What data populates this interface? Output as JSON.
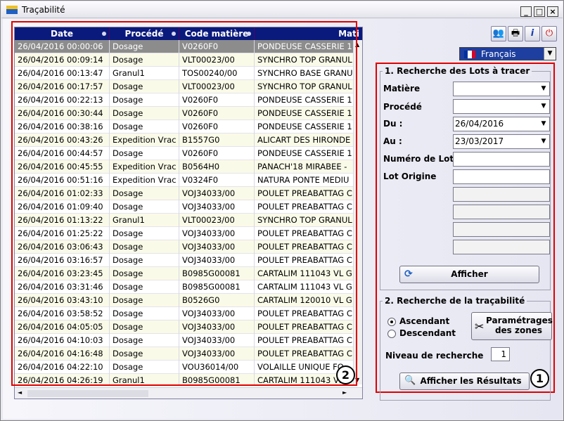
{
  "window": {
    "title": "Traçabilité",
    "controls": [
      "_",
      "□",
      "×"
    ]
  },
  "grid": {
    "columns": [
      "Date",
      "Procédé",
      "Code matière",
      "Mati"
    ],
    "rows": [
      [
        "26/04/2016 00:00:06",
        "Dosage",
        "V0260F0",
        "PONDEUSE CASSERIE 1"
      ],
      [
        "26/04/2016 00:09:14",
        "Dosage",
        "VLT00023/00",
        "SYNCHRO TOP GRANUL"
      ],
      [
        "26/04/2016 00:13:47",
        "Granul1",
        "TOS00240/00",
        "SYNCHRO BASE GRANU"
      ],
      [
        "26/04/2016 00:17:57",
        "Dosage",
        "VLT00023/00",
        "SYNCHRO TOP GRANUL"
      ],
      [
        "26/04/2016 00:22:13",
        "Dosage",
        "V0260F0",
        "PONDEUSE CASSERIE 1"
      ],
      [
        "26/04/2016 00:30:44",
        "Dosage",
        "V0260F0",
        "PONDEUSE CASSERIE 1"
      ],
      [
        "26/04/2016 00:38:16",
        "Dosage",
        "V0260F0",
        "PONDEUSE CASSERIE 1"
      ],
      [
        "26/04/2016 00:43:26",
        "Expedition Vrac",
        "B1557G0",
        "ALICART DES HIRONDE"
      ],
      [
        "26/04/2016 00:44:57",
        "Dosage",
        "V0260F0",
        "PONDEUSE CASSERIE 1"
      ],
      [
        "26/04/2016 00:45:55",
        "Expedition Vrac",
        "B0564H0",
        "PANACH'18 MIRABEE -"
      ],
      [
        "26/04/2016 00:51:16",
        "Expedition Vrac",
        "V0324F0",
        "NATURA PONTE MEDIU"
      ],
      [
        "26/04/2016 01:02:33",
        "Dosage",
        "VOJ34033/00",
        "POULET PREABATTAG C"
      ],
      [
        "26/04/2016 01:09:40",
        "Dosage",
        "VOJ34033/00",
        "POULET PREABATTAG C"
      ],
      [
        "26/04/2016 01:13:22",
        "Granul1",
        "VLT00023/00",
        "SYNCHRO TOP GRANUL"
      ],
      [
        "26/04/2016 01:25:22",
        "Dosage",
        "VOJ34033/00",
        "POULET PREABATTAG C"
      ],
      [
        "26/04/2016 03:06:43",
        "Dosage",
        "VOJ34033/00",
        "POULET PREABATTAG C"
      ],
      [
        "26/04/2016 03:16:57",
        "Dosage",
        "VOJ34033/00",
        "POULET PREABATTAG C"
      ],
      [
        "26/04/2016 03:23:45",
        "Dosage",
        "B0985G00081",
        "CARTALIM 111043 VL G"
      ],
      [
        "26/04/2016 03:31:46",
        "Dosage",
        "B0985G00081",
        "CARTALIM 111043 VL G"
      ],
      [
        "26/04/2016 03:43:10",
        "Dosage",
        "B0526G0",
        "CARTALIM 120010 VL G"
      ],
      [
        "26/04/2016 03:58:52",
        "Dosage",
        "VOJ34033/00",
        "POULET PREABATTAG C"
      ],
      [
        "26/04/2016 04:05:05",
        "Dosage",
        "VOJ34033/00",
        "POULET PREABATTAG C"
      ],
      [
        "26/04/2016 04:10:03",
        "Dosage",
        "VOJ34033/00",
        "POULET PREABATTAG C"
      ],
      [
        "26/04/2016 04:16:48",
        "Dosage",
        "VOJ34033/00",
        "POULET PREABATTAG C"
      ],
      [
        "26/04/2016 04:22:10",
        "Dosage",
        "VOU36014/00",
        "VOLAILLE UNIQUE FO"
      ],
      [
        "26/04/2016 04:26:19",
        "Granul1",
        "B0985G00081",
        "CARTALIM 111043 VL"
      ]
    ]
  },
  "language": {
    "selected": "Français"
  },
  "search_lots": {
    "legend": "1. Recherche des Lots à tracer",
    "fields": [
      {
        "label": "Matière",
        "value": ""
      },
      {
        "label": "Procédé",
        "value": ""
      },
      {
        "label": "Du :",
        "value": "26/04/2016"
      },
      {
        "label": "Au :",
        "value": "23/03/2017"
      },
      {
        "label": "Numéro de Lot",
        "value": ""
      },
      {
        "label": "Lot Origine",
        "value": ""
      }
    ],
    "button": "Afficher"
  },
  "trace": {
    "legend": "2. Recherche de la traçabilité",
    "asc": "Ascendant",
    "desc": "Descendant",
    "zones_button_l1": "Paramétrages",
    "zones_button_l2": "des zones",
    "level_label": "Niveau de recherche",
    "level_value": "1",
    "results_button": "Afficher les Résultats"
  },
  "annotations": {
    "one": "1",
    "two": "2"
  },
  "colors": {
    "header": "#0a1a7c",
    "highlight": "#e00000",
    "selected_row": "#8c8c8c"
  }
}
